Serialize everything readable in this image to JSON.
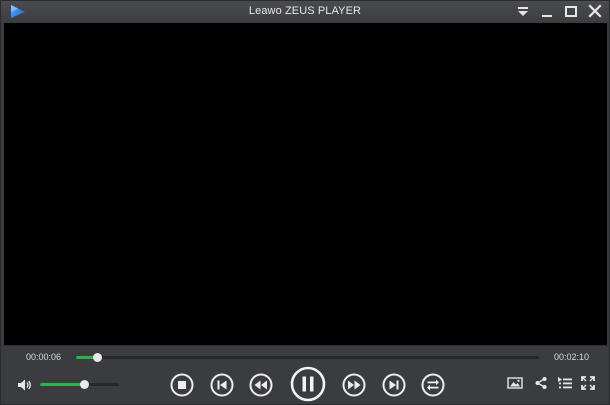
{
  "window": {
    "title": "Leawo ZEUS PLAYER"
  },
  "titlebar": {
    "logo_icon": "play-triangle-logo-icon",
    "buttons": [
      "menu-dropdown-icon",
      "minimize-icon",
      "maximize-icon",
      "close-icon"
    ]
  },
  "playback": {
    "current_time": "00:00:06",
    "total_time": "00:02:10",
    "progress_fraction": 0.046,
    "volume_fraction": 0.56,
    "state": "playing"
  },
  "controls": {
    "center_buttons": [
      "stop-icon",
      "previous-icon",
      "rewind-icon",
      "pause-icon",
      "fast-forward-icon",
      "next-icon",
      "repeat-icon"
    ],
    "right_buttons": [
      "snapshot-icon",
      "share-icon",
      "playlist-icon",
      "fullscreen-icon"
    ]
  },
  "colors": {
    "accent": "#2fb24b",
    "logo": "#2a7fe0",
    "control_bg": "#3b3c40",
    "video_bg": "#000000"
  }
}
